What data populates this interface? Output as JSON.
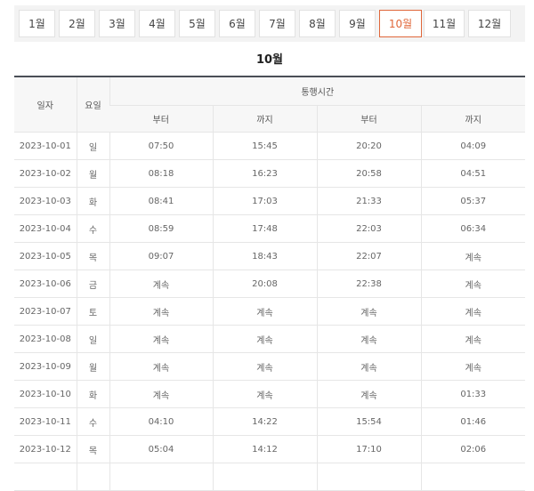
{
  "months": [
    "1월",
    "2월",
    "3월",
    "4월",
    "5월",
    "6월",
    "7월",
    "8월",
    "9월",
    "10월",
    "11월",
    "12월"
  ],
  "active_month_index": 9,
  "section_title": "10월",
  "table": {
    "col_date": "일자",
    "col_day": "요일",
    "group_header": "통행시간",
    "sub_headers": [
      "부터",
      "까지",
      "부터",
      "까지"
    ],
    "rows": [
      [
        "2023-10-01",
        "일",
        "07:50",
        "15:45",
        "20:20",
        "04:09"
      ],
      [
        "2023-10-02",
        "월",
        "08:18",
        "16:23",
        "20:58",
        "04:51"
      ],
      [
        "2023-10-03",
        "화",
        "08:41",
        "17:03",
        "21:33",
        "05:37"
      ],
      [
        "2023-10-04",
        "수",
        "08:59",
        "17:48",
        "22:03",
        "06:34"
      ],
      [
        "2023-10-05",
        "목",
        "09:07",
        "18:43",
        "22:07",
        "계속"
      ],
      [
        "2023-10-06",
        "금",
        "계속",
        "20:08",
        "22:38",
        "계속"
      ],
      [
        "2023-10-07",
        "토",
        "계속",
        "계속",
        "계속",
        "계속"
      ],
      [
        "2023-10-08",
        "일",
        "계속",
        "계속",
        "계속",
        "계속"
      ],
      [
        "2023-10-09",
        "월",
        "계속",
        "계속",
        "계속",
        "계속"
      ],
      [
        "2023-10-10",
        "화",
        "계속",
        "계속",
        "계속",
        "01:33"
      ],
      [
        "2023-10-11",
        "수",
        "04:10",
        "14:22",
        "15:54",
        "01:46"
      ],
      [
        "2023-10-12",
        "목",
        "05:04",
        "14:12",
        "17:10",
        "02:06"
      ],
      [
        "",
        "",
        "",
        "",
        "",
        ""
      ]
    ]
  }
}
